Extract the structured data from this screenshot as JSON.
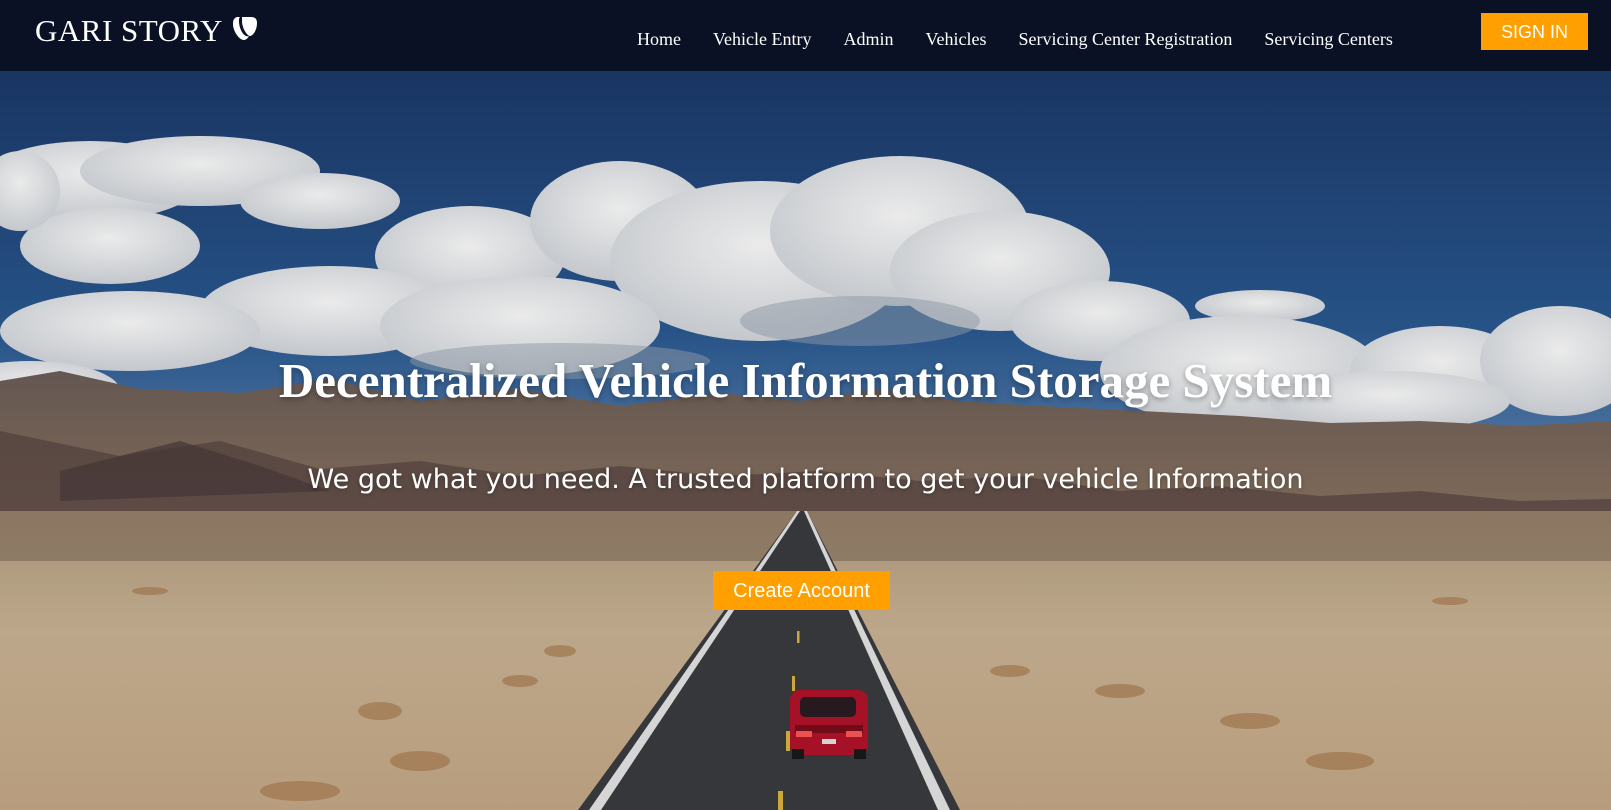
{
  "brand": {
    "name": "GARI STORY",
    "logo_icon": "typo3-logo-icon"
  },
  "nav": {
    "items": [
      {
        "label": "Home"
      },
      {
        "label": "Vehicle Entry"
      },
      {
        "label": "Admin"
      },
      {
        "label": "Vehicles"
      },
      {
        "label": "Servicing Center Registration"
      },
      {
        "label": "Servicing Centers"
      }
    ],
    "sign_in_label": "SIGN IN"
  },
  "hero": {
    "title": "Decentralized Vehicle Information Storage System",
    "subtitle": "We got what you need. A trusted platform to get your vehicle Information",
    "cta_label": "Create Account",
    "background_image": "desert-road-red-car-photo"
  },
  "colors": {
    "nav_background": "#0b1124",
    "accent": "#ffa000",
    "text": "#ffffff"
  }
}
